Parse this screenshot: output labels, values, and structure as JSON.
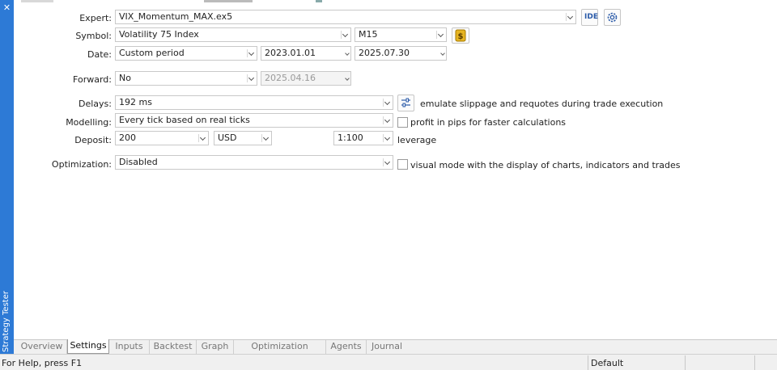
{
  "side_panel": {
    "title": "Strategy Tester",
    "close_glyph": "✕",
    "accent": "#2d7ad6"
  },
  "labels": {
    "expert": "Expert:",
    "symbol": "Symbol:",
    "date": "Date:",
    "forward": "Forward:",
    "delays": "Delays:",
    "modelling": "Modelling:",
    "deposit": "Deposit:",
    "optimization": "Optimization:"
  },
  "expert": {
    "value": "VIX_Momentum_MAX.ex5",
    "ide_label": "IDE",
    "settings_icon": "gear-icon"
  },
  "symbol": {
    "value": "Volatility 75 Index",
    "timeframe": "M15",
    "spec_icon": "dollar-icon"
  },
  "date": {
    "period": "Custom period",
    "from": "2023.01.01",
    "to": "2025.07.30"
  },
  "forward": {
    "value": "No",
    "date": "2025.04.16"
  },
  "delays": {
    "value": "192 ms",
    "settings_icon": "sliders-icon",
    "description": "emulate slippage and requotes during trade execution"
  },
  "modelling": {
    "value": "Every tick based on real ticks",
    "checkbox_label": "profit in pips for faster calculations",
    "checked": false
  },
  "deposit": {
    "amount": "200",
    "currency": "USD",
    "leverage": "1:100",
    "leverage_label": "leverage"
  },
  "optimization": {
    "value": "Disabled",
    "checkbox_label": "visual mode with the display of charts, indicators and trades",
    "checked": false
  },
  "tabs": [
    "Overview",
    "Settings",
    "Inputs",
    "Backtest",
    "Graph",
    "Optimization Results",
    "Agents",
    "Journal"
  ],
  "active_tab": "Settings",
  "status": {
    "help": "For Help, press F1",
    "profile": "Default"
  }
}
